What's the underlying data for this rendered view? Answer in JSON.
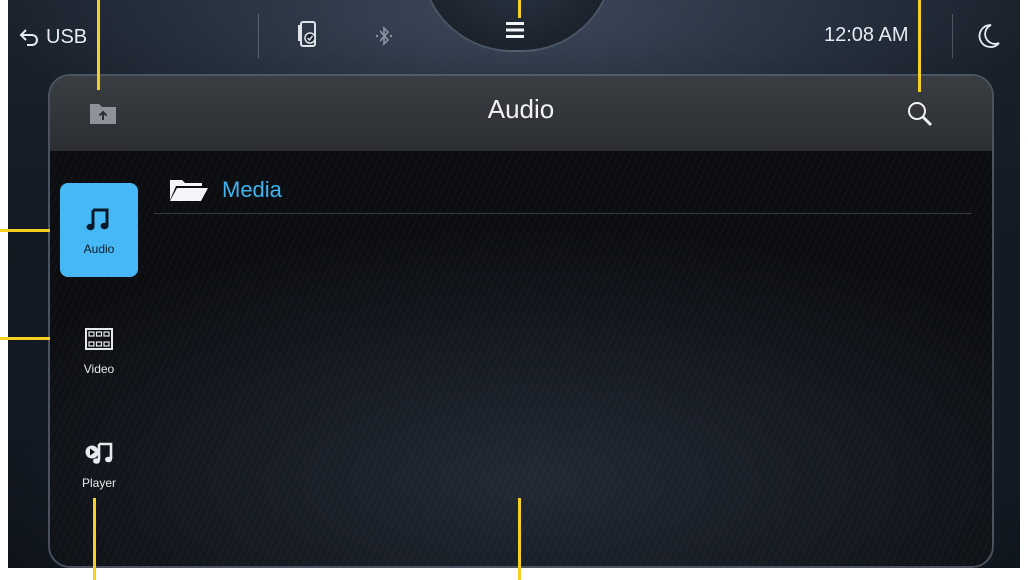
{
  "statusbar": {
    "back_label": "USB",
    "time": "12:08 AM",
    "icons": [
      "back-arrow-icon",
      "phone-sync-icon",
      "bluetooth-icon",
      "menu-icon",
      "night-mode-icon"
    ]
  },
  "panel": {
    "title": "Audio",
    "header_icons": [
      "folder-up-icon",
      "search-icon"
    ]
  },
  "sidebar": {
    "items": [
      {
        "label": "Audio",
        "icon": "music-note-icon",
        "active": true
      },
      {
        "label": "Video",
        "icon": "film-icon",
        "active": false
      },
      {
        "label": "Player",
        "icon": "player-icon",
        "active": false
      }
    ]
  },
  "files": [
    {
      "name": "Media",
      "icon": "folder-icon"
    }
  ],
  "colors": {
    "accent": "#45b8f5",
    "folder_text": "#3fb4ee",
    "callout": "#f5d020"
  }
}
